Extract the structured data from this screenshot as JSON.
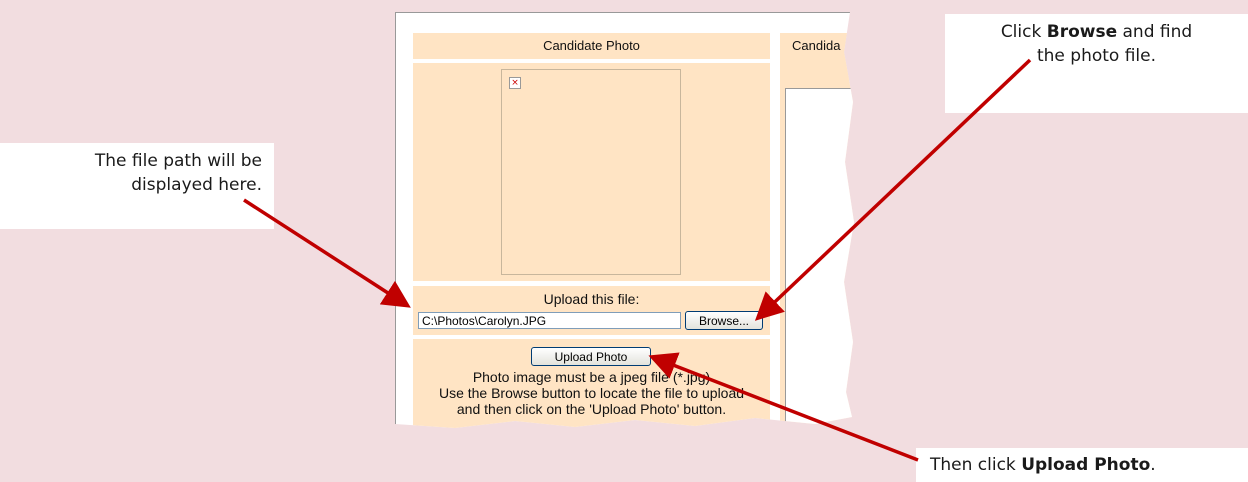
{
  "callouts": {
    "path_line1": "The file path will be",
    "path_line2": "displayed here.",
    "browse_pre": "Click ",
    "browse_bold": "Browse",
    "browse_post": " and find",
    "browse_line2": "the photo file.",
    "upload_pre": "Then click ",
    "upload_bold": "Upload Photo",
    "upload_post": "."
  },
  "form": {
    "photo_header": "Candidate Photo",
    "candidate_header": "Candida",
    "upload_label": "Upload this file:",
    "file_path_value": "C:\\Photos\\Carolyn.JPG",
    "browse_label": "Browse...",
    "upload_button_label": "Upload Photo",
    "info_line1": "Photo image must be a jpeg file (*.jpg)",
    "info_line2": "Use the Browse button to locate the file to upload",
    "info_line3": "and then click on the 'Upload Photo' button."
  },
  "colors": {
    "page_background": "#f2dde0",
    "panel_fill": "#ffe4c4",
    "arrow": "#c00000"
  }
}
